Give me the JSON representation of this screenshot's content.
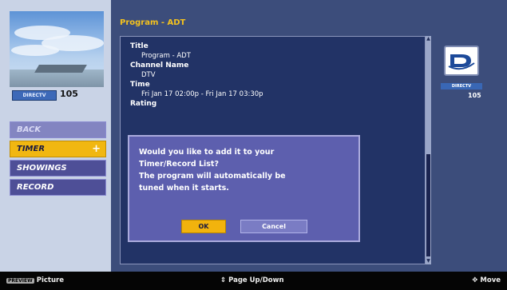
{
  "preview": {
    "channel_badge": "DIRECTV",
    "channel_number": "105"
  },
  "menu": {
    "items": [
      {
        "label": "BACK",
        "state": "dim"
      },
      {
        "label": "TIMER",
        "state": "selected",
        "indicator": "+"
      },
      {
        "label": "SHOWINGS",
        "state": "normal"
      },
      {
        "label": "RECORD",
        "state": "normal"
      }
    ]
  },
  "program": {
    "title_bar": "Program - ADT",
    "title_label": "Title",
    "title_value": "Program - ADT",
    "channel_label": "Channel Name",
    "channel_value": "DTV",
    "time_label": "Time",
    "time_value": "Fri Jan 17 02:00p - Fri Jan 17 03:30p",
    "rating_label": "Rating"
  },
  "dialog": {
    "line1": "Would you like to add it to your",
    "line2": "Timer/Record List?",
    "line3": "The program will automatically be",
    "line4": "tuned when it starts.",
    "ok_label": "OK",
    "cancel_label": "Cancel"
  },
  "logo": {
    "label": "DIRECTV",
    "number": "105"
  },
  "footer": {
    "left_key": "PREVIEW",
    "left_label": "Picture",
    "mid_label": "Page Up/Down",
    "right_label": "Move"
  },
  "colors": {
    "accent": "#f1b711",
    "panel": "#223366",
    "dialog": "#5d5fae"
  }
}
